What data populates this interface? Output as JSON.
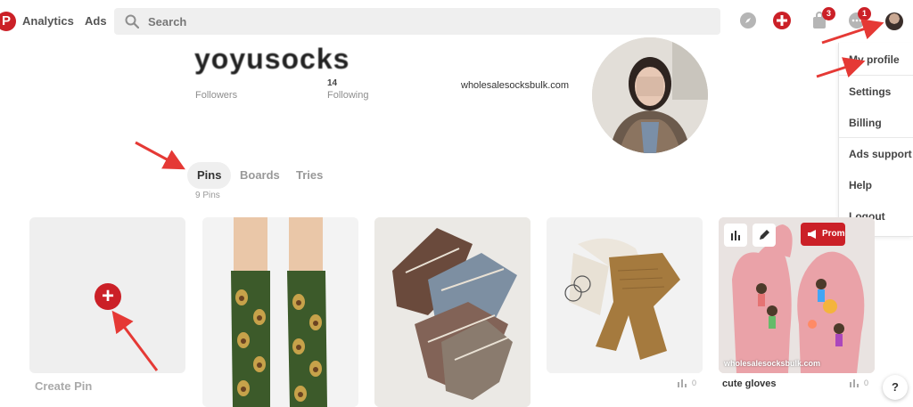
{
  "topbar": {
    "logo": "P",
    "analytics_label": "Analytics",
    "ads_label": "Ads",
    "search_placeholder": "Search",
    "cart_badge": "3",
    "messages_badge": "1"
  },
  "profile": {
    "username": "yoyusocks",
    "followers_count": "",
    "followers_label": "Followers",
    "following_count": "14",
    "following_label": "Following",
    "website": "wholesalesocksbulk.com"
  },
  "dropdown": {
    "items": [
      "My profile",
      "Settings",
      "Billing",
      "Ads support",
      "Help",
      "Logout"
    ]
  },
  "tabs": {
    "items": [
      "Pins",
      "Boards",
      "Tries"
    ],
    "active": "Pins",
    "pins_count": "9 Pins"
  },
  "grid": {
    "create_label": "Create Pin",
    "create_plus": "+",
    "pins": [
      {
        "saves": ""
      },
      {
        "saves": ""
      },
      {
        "saves": "0"
      },
      {
        "title": "cute gloves",
        "saves": "0",
        "source": "wholesalesocksbulk.com",
        "promote_label": "Promote"
      }
    ]
  },
  "help_label": "?",
  "colors": {
    "brand": "#cb2027",
    "annotation_arrow": "#e53935"
  }
}
